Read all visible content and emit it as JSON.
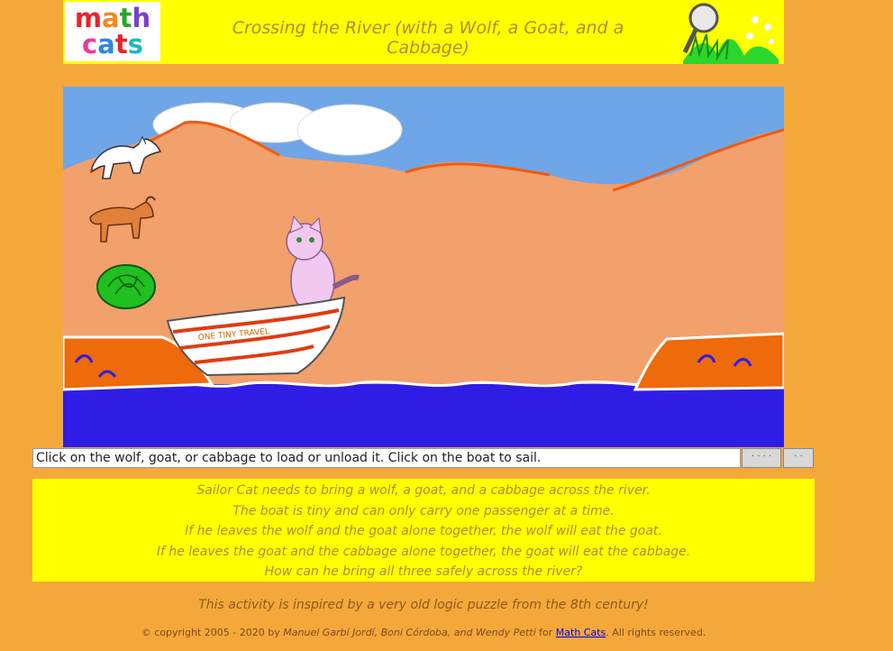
{
  "header": {
    "logo_line1": "math",
    "logo_line2": "cats",
    "title": "Crossing the River (with a Wolf, a Goat, and a Cabbage)"
  },
  "scene": {
    "boat_name": "ONE TINY TRAVEL",
    "colors": {
      "sky": "#6fa6e8",
      "sand": "#f2a06c",
      "river": "#2f1de6",
      "bank": "#ee6a0a"
    }
  },
  "message": "Click on the wolf, goat, or cabbage to load or unload it.  Click on the boat to sail.",
  "controls": {
    "button1": "· · · ·",
    "button2": "· ·"
  },
  "story": [
    "Sailor Cat needs to bring a wolf, a goat, and a cabbage across the river.",
    "The boat is tiny and can only carry one passenger at a time.",
    "If he leaves the wolf and the goat alone together, the wolf will eat the goat.",
    "If he leaves the goat and the cabbage alone together, the goat will eat the cabbage.",
    "How can he bring all three safely across the river?"
  ],
  "footer": {
    "inspired": "This activity is inspired by a very old logic puzzle from the 8th century!",
    "copyright_prefix": "© copyright 2005 - 2020 by",
    "authors": "Manuel Garbí Jordí, Boni Córdoba, and Wendy Petti",
    "copyright_for": "for",
    "link_text": "Math Cats",
    "rights": ". All rights reserved."
  }
}
